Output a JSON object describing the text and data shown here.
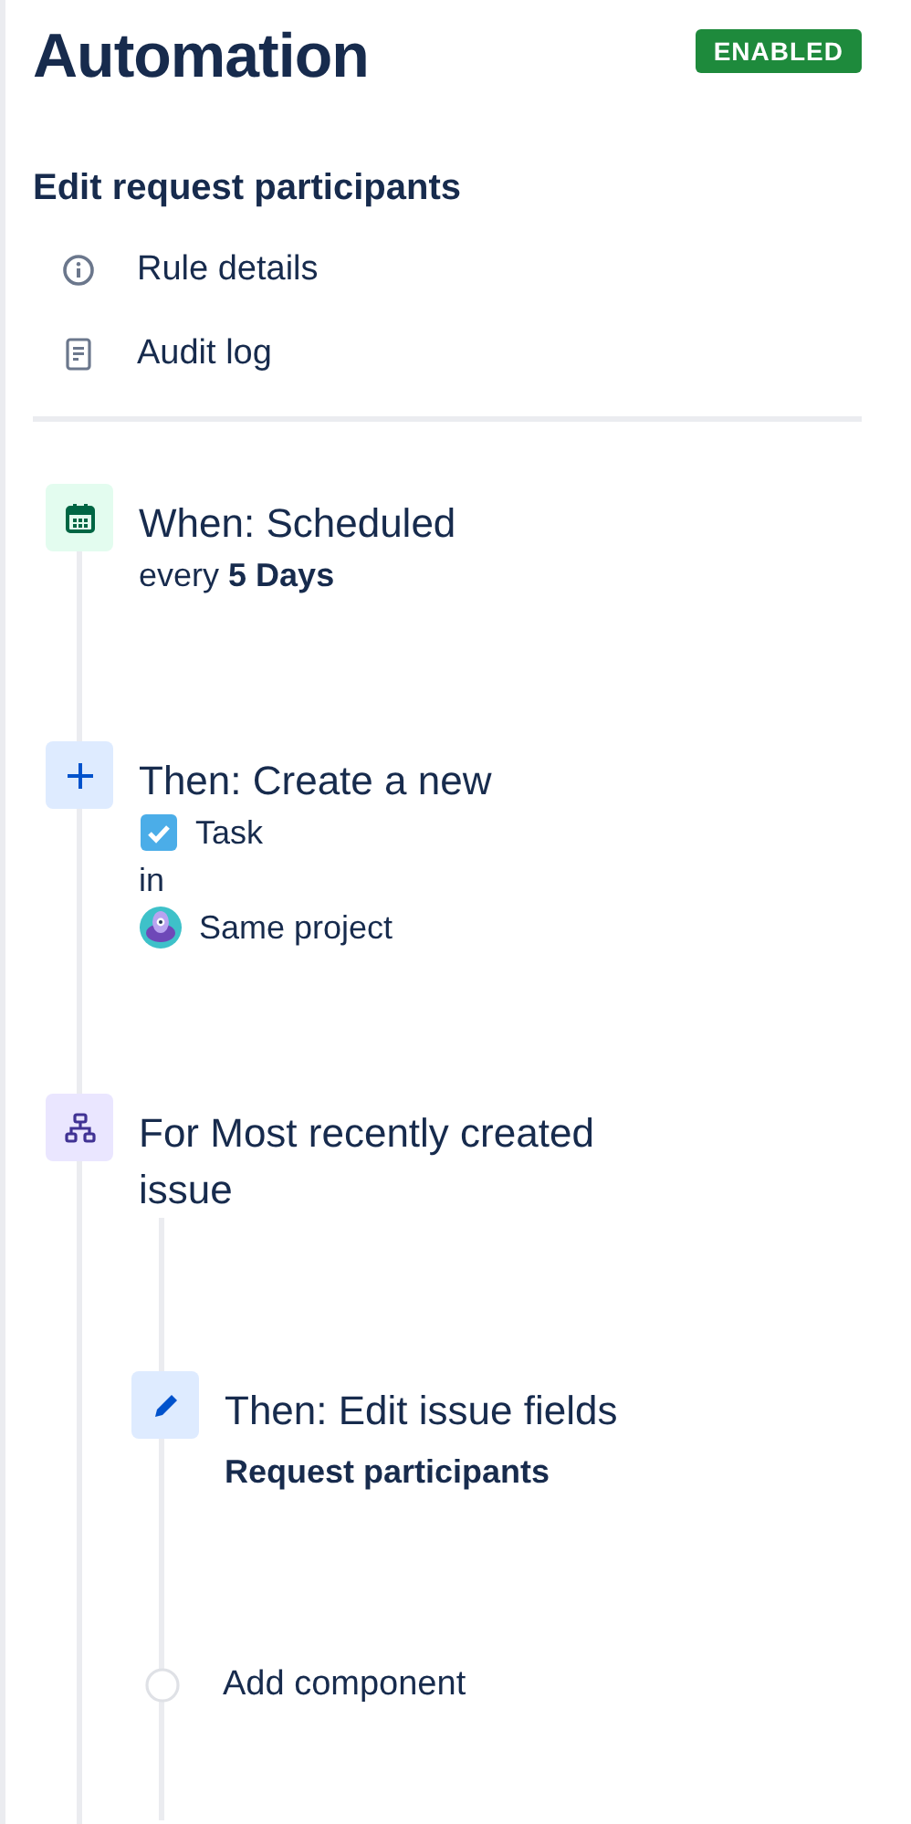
{
  "header": {
    "title": "Automation",
    "status": "ENABLED"
  },
  "rule": {
    "name": "Edit request participants"
  },
  "links": [
    {
      "kind": "info",
      "label": "Rule details"
    },
    {
      "kind": "log",
      "label": "Audit log"
    }
  ],
  "steps": [
    {
      "kind": "trigger",
      "title": "When: Scheduled",
      "lines": [
        {
          "kind": "text",
          "text": "every **5 Days**"
        }
      ]
    },
    {
      "kind": "action",
      "title": "Then: Create a new",
      "lines": [
        {
          "kind": "task",
          "text": "Task"
        },
        {
          "kind": "text",
          "text": "in"
        },
        {
          "kind": "project",
          "text": "Same project"
        }
      ]
    },
    {
      "kind": "branch",
      "title": "For Most recently created issue",
      "children": [
        {
          "kind": "edit",
          "title": "Then: Edit issue fields",
          "lines": [
            {
              "kind": "strong",
              "text": "Request participants"
            }
          ]
        }
      ],
      "add": "Add component"
    }
  ]
}
